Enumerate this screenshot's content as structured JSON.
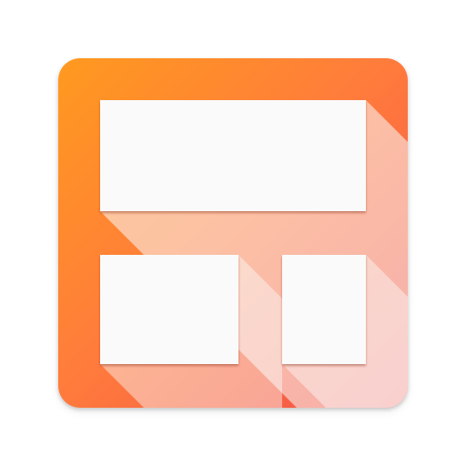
{
  "icon": {
    "name": "layout-grid-app-icon",
    "colors": {
      "gradient_start": "#FF9A1F",
      "gradient_mid": "#FF7A3D",
      "gradient_end": "#F2504A",
      "tile_fill": "#FAFAFA",
      "long_shadow": "#C83F1E",
      "tile_edge_shadow": "#8A2E12"
    }
  }
}
